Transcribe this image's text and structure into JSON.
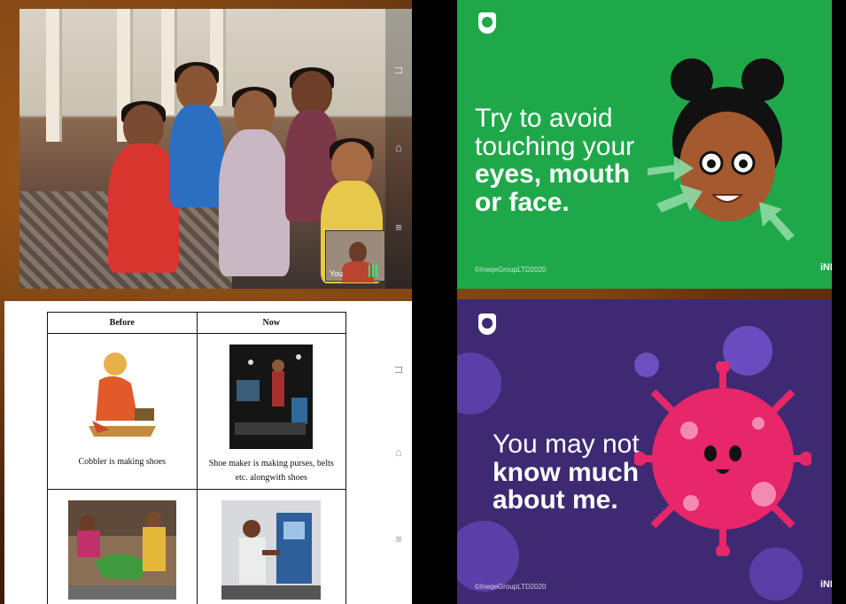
{
  "video_call": {
    "self_view_label": "You",
    "controls": [
      "back-icon",
      "home-icon",
      "menu-icon"
    ]
  },
  "green_slide": {
    "line1": "Try to avoid",
    "line2": "touching your",
    "line3": "eyes, mouth",
    "line4": "or face.",
    "copyright": "©IneqeGroupLTD2020",
    "brand": "iNEQE",
    "bg_color": "#1fa84a"
  },
  "document": {
    "headers": [
      "Before",
      "Now"
    ],
    "rows": [
      {
        "before_caption": "Cobbler is making shoes",
        "now_caption": "Shoe maker is making purses, belts etc. alongwith shoes"
      },
      {
        "before_caption": "",
        "now_caption": ""
      }
    ],
    "controls": [
      "back-icon",
      "home-icon",
      "menu-icon"
    ]
  },
  "purple_slide": {
    "line1": "You may not",
    "line2": "know much",
    "line3": "about me.",
    "copyright": "©IneqeGroupLTD2020",
    "brand": "iNEQE",
    "bg_color": "#3e2a72",
    "virus_color": "#e8266a"
  }
}
